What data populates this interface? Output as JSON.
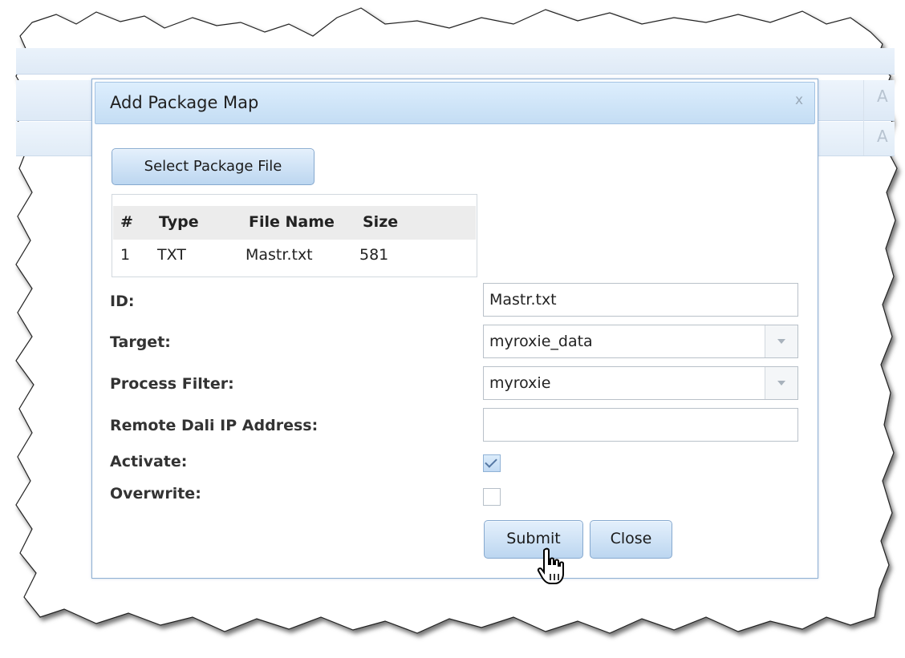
{
  "background": {
    "strip_letters": [
      "A",
      "A"
    ]
  },
  "dialog": {
    "title": "Add Package Map",
    "close_glyph": "x",
    "select_button": "Select Package File",
    "files_table": {
      "headers": [
        "#",
        "Type",
        "File Name",
        "Size"
      ],
      "rows": [
        [
          "1",
          "TXT",
          "Mastr.txt",
          "581"
        ]
      ]
    },
    "form": {
      "id_label": "ID:",
      "id_value": "Mastr.txt",
      "target_label": "Target:",
      "target_value": "myroxie_data",
      "filter_label": "Process Filter:",
      "filter_value": "myroxie",
      "dali_label": "Remote Dali IP Address:",
      "dali_value": "",
      "activate_label": "Activate:",
      "activate_checked": true,
      "overwrite_label": "Overwrite:",
      "overwrite_checked": false
    },
    "submit_label": "Submit",
    "close_label": "Close"
  },
  "colors": {
    "title_bar": "#c4ddf4",
    "button": "#bcd6f0",
    "border": "#8fb0d3"
  },
  "icons": {
    "close": "close-icon",
    "dropdown": "chevron-down-icon",
    "check": "checkmark-icon",
    "cursor": "hand-pointer-icon"
  }
}
